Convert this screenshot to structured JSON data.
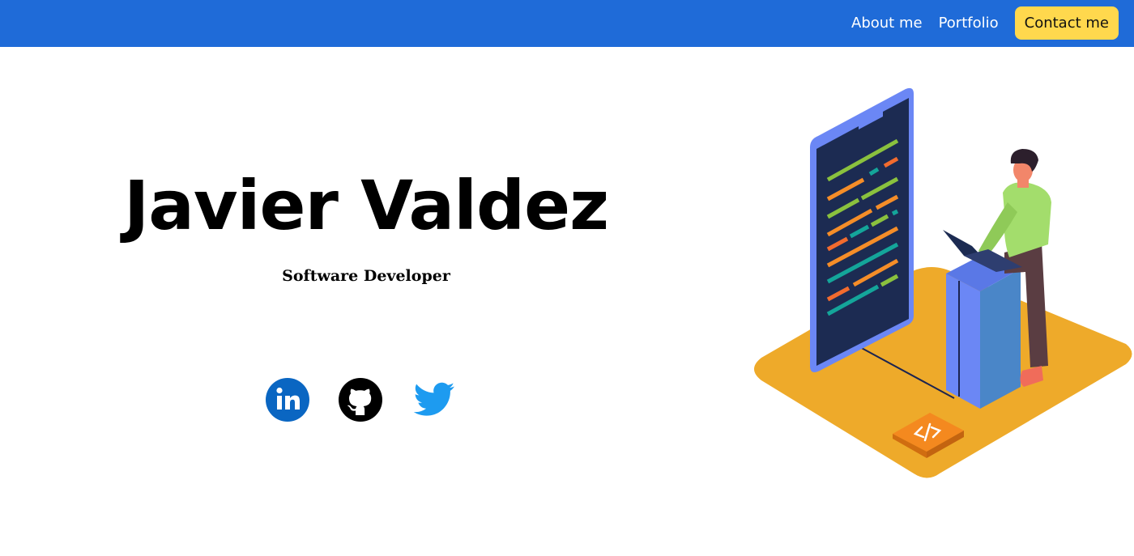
{
  "nav": {
    "links": [
      {
        "label": "About me"
      },
      {
        "label": "Portfolio"
      }
    ],
    "contact_label": "Contact me"
  },
  "hero": {
    "name": "Javier Valdez",
    "role": "Software Developer"
  },
  "social": [
    {
      "icon": "linkedin-icon",
      "color": "#0a66c2"
    },
    {
      "icon": "github-icon",
      "color": "#000000"
    },
    {
      "icon": "twitter-icon",
      "color": "#1d9bf0"
    }
  ],
  "colors": {
    "navbar": "#1f6bd8",
    "contact_button": "#ffd84d",
    "platform": "#eeaa2a",
    "screen_frame": "#6b87f5",
    "screen": "#1c2b52",
    "pillar_front": "#6b87f5",
    "pillar_side": "#4a86c8",
    "shirt": "#a3dd6c",
    "pants": "#5a3d42",
    "tag": "#f4891f"
  }
}
